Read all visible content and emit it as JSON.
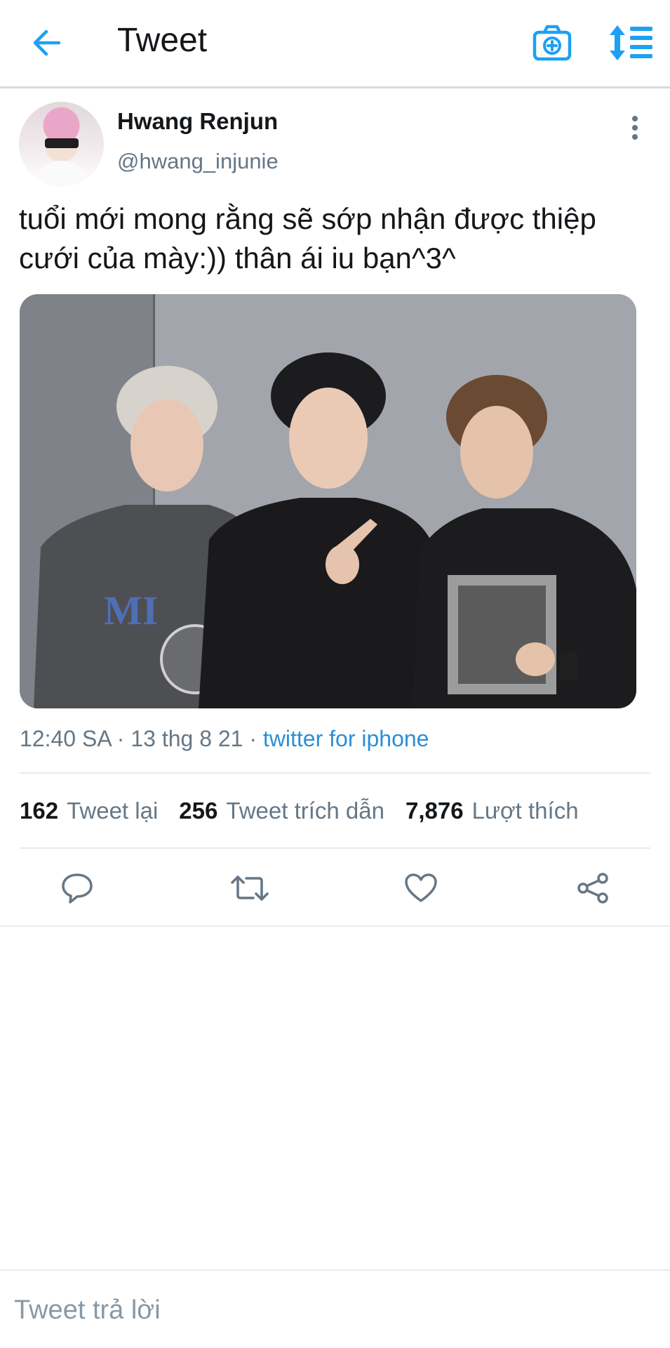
{
  "header": {
    "title": "Tweet",
    "back_icon": "arrow-left-icon",
    "camera_icon": "camera-add-icon",
    "sort_icon": "sort-list-icon",
    "accent_color": "#1da1f2"
  },
  "tweet": {
    "author": {
      "name": "Hwang Renjun",
      "handle": "@hwang_injunie"
    },
    "text": "tuổi mới mong rằng sẽ sớp nhận được thiệp cưới của mày:)) thân ái iu bạn^3^",
    "meta": {
      "time_date": "12:40 SA · 13 thg 8 21 · ",
      "source": "twitter for iphone"
    },
    "stats": {
      "retweets_count": "162",
      "retweets_label": "Tweet lại",
      "quotes_count": "256",
      "quotes_label": "Tweet trích dẫn",
      "likes_count": "7,876",
      "likes_label": "Lượt thích"
    },
    "actions": [
      "reply-icon",
      "retweet-icon",
      "like-icon",
      "share-icon"
    ]
  },
  "reply": {
    "placeholder": "Tweet trả lời"
  }
}
